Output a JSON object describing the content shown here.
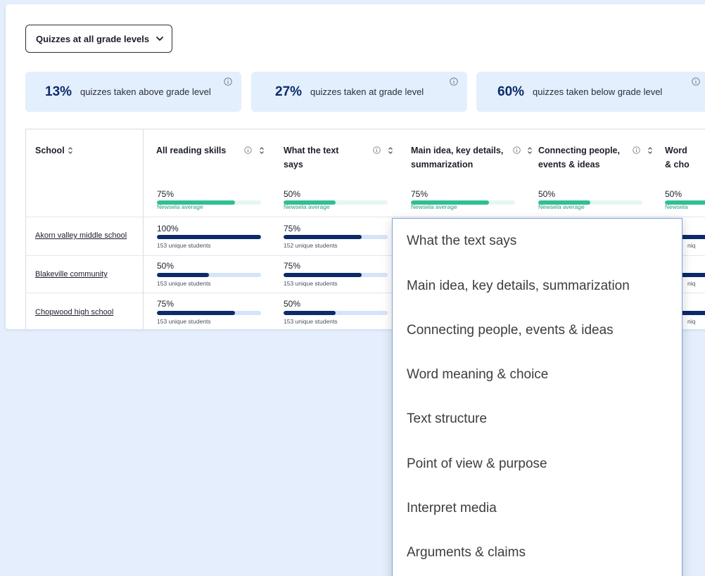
{
  "grade_filter": {
    "label": "Quizzes at all grade levels"
  },
  "stats": [
    {
      "pct": "13%",
      "text": "quizzes taken above grade level"
    },
    {
      "pct": "27%",
      "text": "quizzes taken at  grade level"
    },
    {
      "pct": "60%",
      "text": "quizzes taken below grade level"
    }
  ],
  "table": {
    "school_header": "School",
    "columns": [
      {
        "title_line1": "All reading skills",
        "title_line2": "",
        "avg_pct": "75%",
        "avg_value": 0.75,
        "avg_label": "Newsela average"
      },
      {
        "title_line1": "What the text",
        "title_line2": "says",
        "avg_pct": "50%",
        "avg_value": 0.5,
        "avg_label": "Newsela average"
      },
      {
        "title_line1": "Main idea, key details,",
        "title_line2": "summarization",
        "avg_pct": "75%",
        "avg_value": 0.75,
        "avg_label": "Newsela average"
      },
      {
        "title_line1": "Connecting people,",
        "title_line2": "events & ideas",
        "avg_pct": "50%",
        "avg_value": 0.5,
        "avg_label": "Newsela average"
      },
      {
        "title_line1": "Word",
        "title_line2": "& cho",
        "avg_pct": "50%",
        "avg_value": 0.5,
        "avg_label": "Newsela"
      }
    ],
    "rows": [
      {
        "school": "Akorn valley middle school",
        "cells": [
          {
            "pct": "100%",
            "value": 1.0,
            "sub": "153 unique students"
          },
          {
            "pct": "75%",
            "value": 0.75,
            "sub": "152 unique students"
          }
        ],
        "edge": "niq"
      },
      {
        "school": "Blakeville community",
        "cells": [
          {
            "pct": "50%",
            "value": 0.5,
            "sub": "153 unique students"
          },
          {
            "pct": "75%",
            "value": 0.75,
            "sub": "153 unique students"
          }
        ],
        "edge": "niq"
      },
      {
        "school": "Chopwood high school",
        "cells": [
          {
            "pct": "75%",
            "value": 0.75,
            "sub": "153 unique students"
          },
          {
            "pct": "50%",
            "value": 0.5,
            "sub": "153 unique students"
          }
        ],
        "edge": "niq"
      }
    ]
  },
  "skill_menu": {
    "items": [
      "What the text says",
      "Main idea, key details, summarization",
      "Connecting people, events & ideas",
      "Word meaning & choice",
      "Text structure",
      "Point of view & purpose",
      "Interpret media",
      "Arguments & claims"
    ]
  },
  "colors": {
    "page_bg": "#e4eefc",
    "stat_bg": "#e3effd",
    "navy": "#0d2b6b",
    "teal": "#2fbf94",
    "dropdown_border": "#7aa3e0"
  },
  "icons": [
    "chevron-down-icon",
    "info-icon",
    "sort-icon"
  ]
}
